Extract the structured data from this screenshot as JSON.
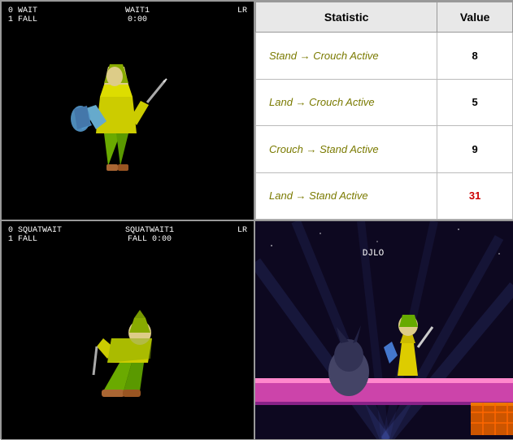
{
  "cells": {
    "top_left": {
      "hud": {
        "top_left_line1": "0 WAIT",
        "top_left_line2": "1 FALL",
        "top_right_line1": "WAIT1",
        "top_right_line2": "0:00",
        "side": "LR"
      }
    },
    "top_right": {
      "header": {
        "statistic": "Statistic",
        "value": "Value"
      },
      "rows": [
        {
          "name": "Stand → Crouch Active",
          "value": "8",
          "highlight": false
        },
        {
          "name": "Land → Crouch Active",
          "value": "5",
          "highlight": false
        },
        {
          "name": "Crouch → Stand Active",
          "value": "9",
          "highlight": false
        },
        {
          "name": "Land → Stand Active",
          "value": "31",
          "highlight": true
        }
      ]
    },
    "bottom_left": {
      "hud": {
        "top_left_line1": "0 SQUATWAIT",
        "top_left_line2": "1 FALL",
        "top_right_line1": "SQUATWAIT1",
        "top_right_line2": "FALL",
        "time": "0:00",
        "side": "LR"
      }
    },
    "bottom_right": {
      "label": "DJLO"
    }
  }
}
